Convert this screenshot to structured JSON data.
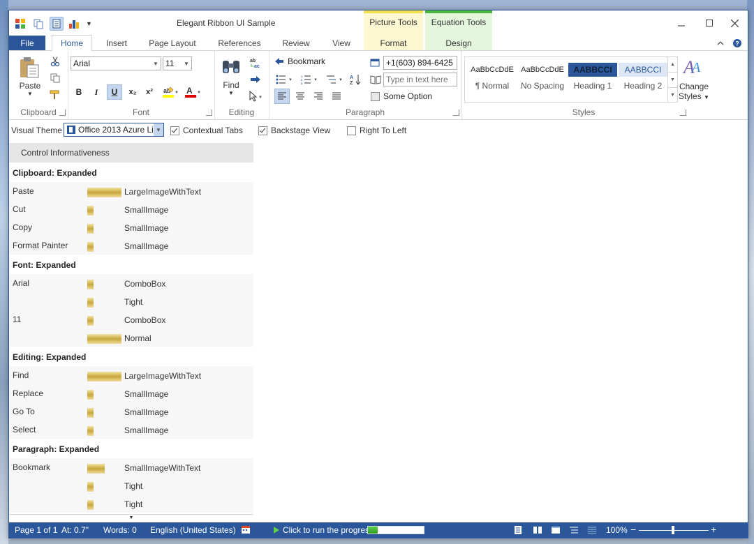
{
  "window": {
    "title": "Elegant Ribbon UI Sample"
  },
  "contextual": {
    "picture": {
      "group": "Picture Tools",
      "tab": "Format"
    },
    "equation": {
      "group": "Equation Tools",
      "tab": "Design"
    }
  },
  "tabs": [
    "File",
    "Home",
    "Insert",
    "Page Layout",
    "References",
    "Review",
    "View"
  ],
  "ribbon": {
    "clipboard": {
      "label": "Clipboard",
      "paste": "Paste"
    },
    "font": {
      "label": "Font",
      "family": "Arial",
      "size": "11",
      "bold": "B",
      "italic": "I",
      "underline": "U",
      "subscript": "x₂",
      "superscript": "x²"
    },
    "editing": {
      "label": "Editing",
      "find": "Find"
    },
    "paragraph": {
      "label": "Paragraph",
      "bookmark": "Bookmark",
      "phone": "+1(603) 894-6425",
      "text_placeholder": "Type in text here",
      "some_option": "Some Option"
    },
    "styles": {
      "label": "Styles",
      "items": [
        {
          "sample": "AaBbCcDdE",
          "name": "¶ Normal"
        },
        {
          "sample": "AaBbCcDdE",
          "name": "No Spacing"
        },
        {
          "sample": "AABBCCI",
          "name": "Heading 1"
        },
        {
          "sample": "AABBCCI",
          "name": "Heading 2"
        }
      ],
      "change_styles": "Change Styles"
    }
  },
  "options": {
    "visual_theme_label": "Visual Theme",
    "visual_theme_value": "Office 2013 Azure Light",
    "contextual_tabs": "Contextual Tabs",
    "backstage_view": "Backstage View",
    "right_to_left": "Right To Left"
  },
  "panel": {
    "header": "Control Informativeness",
    "rows": [
      {
        "type": "section",
        "text": "Clipboard: Expanded"
      },
      {
        "name": "Paste",
        "bar": "wide",
        "value": "LargeImageWithText"
      },
      {
        "name": "Cut",
        "bar": "thin",
        "value": "SmallImage"
      },
      {
        "name": "Copy",
        "bar": "thin",
        "value": "SmallImage"
      },
      {
        "name": "Format Painter",
        "bar": "thin",
        "value": "SmallImage"
      },
      {
        "type": "section",
        "text": "Font: Expanded"
      },
      {
        "name": "Arial",
        "bar": "thin",
        "value": "ComboBox"
      },
      {
        "name": "",
        "bar": "thin",
        "value": "Tight"
      },
      {
        "name": "11",
        "bar": "thin",
        "value": "ComboBox"
      },
      {
        "name": "",
        "bar": "wide",
        "value": "Normal"
      },
      {
        "type": "section",
        "text": "Editing: Expanded"
      },
      {
        "name": "Find",
        "bar": "wide",
        "value": "LargeImageWithText"
      },
      {
        "name": "Replace",
        "bar": "thin",
        "value": "SmallImage"
      },
      {
        "name": "Go To",
        "bar": "thin",
        "value": "SmallImage"
      },
      {
        "name": "Select",
        "bar": "thin",
        "value": "SmallImage"
      },
      {
        "type": "section",
        "text": "Paragraph: Expanded"
      },
      {
        "name": "Bookmark",
        "bar": "mid",
        "value": "SmallImageWithText"
      },
      {
        "name": "",
        "bar": "thin",
        "value": "Tight"
      },
      {
        "name": "",
        "bar": "thin",
        "value": "Tight"
      }
    ]
  },
  "status": {
    "page": "Page 1 of 1",
    "at": "At: 0.7\"",
    "words": "Words: 0",
    "language": "English (United States)",
    "progress_label": "Click to run the progress",
    "progress_fraction": 0.18,
    "zoom": "100%",
    "zoom_fraction": 0.47
  },
  "colors": {
    "accent": "#2b579a",
    "picture_ctx": "#f2e14c",
    "equation_ctx": "#4cb53f"
  }
}
